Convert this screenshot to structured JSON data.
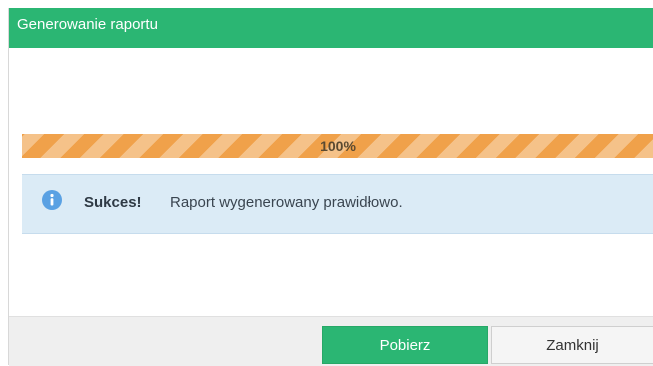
{
  "dialog": {
    "title": "Generowanie raportu"
  },
  "progress": {
    "percent": 100,
    "label": "100%"
  },
  "alert": {
    "icon": "info-icon",
    "strong": "Sukces!",
    "message": "Raport wygenerowany prawidłowo."
  },
  "footer": {
    "download_label": "Pobierz",
    "close_label": "Zamknij"
  },
  "colors": {
    "header": "#2bb673",
    "progress": "#f0a14a",
    "alert_bg": "#dbebf6",
    "info_icon": "#5aa1e3"
  }
}
